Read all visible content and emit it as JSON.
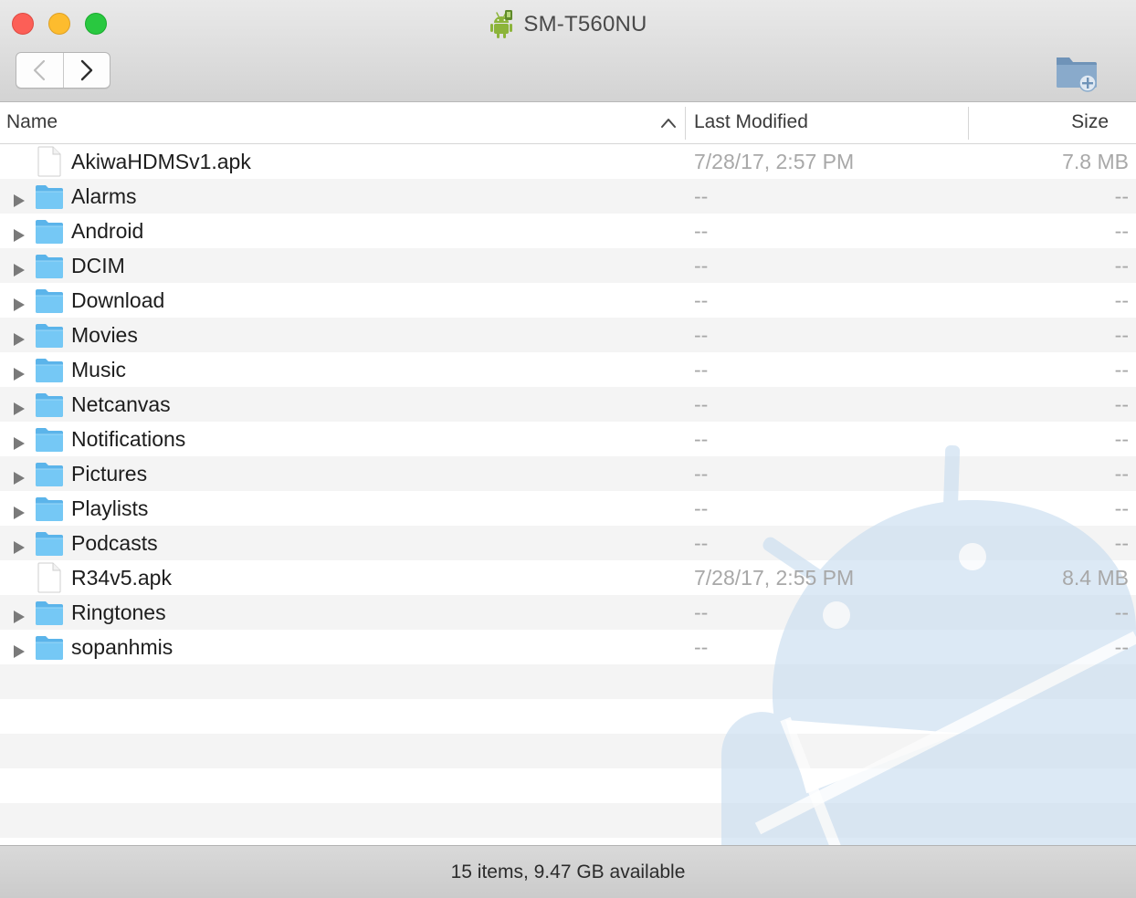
{
  "window": {
    "title": "SM-T560NU",
    "title_icon": "android-icon"
  },
  "toolbar": {
    "back_icon": "chevron-left-icon",
    "forward_icon": "chevron-right-icon",
    "new_folder_icon": "new-folder-icon"
  },
  "columns": {
    "name": "Name",
    "last_modified": "Last Modified",
    "size": "Size",
    "sort_indicator": "chevron-up-icon"
  },
  "rows": [
    {
      "name": "AkiwaHDMSv1.apk",
      "modified": "7/28/17, 2:57 PM",
      "size": "7.8 MB",
      "kind": "file"
    },
    {
      "name": "Alarms",
      "modified": "--",
      "size": "--",
      "kind": "folder"
    },
    {
      "name": "Android",
      "modified": "--",
      "size": "--",
      "kind": "folder"
    },
    {
      "name": "DCIM",
      "modified": "--",
      "size": "--",
      "kind": "folder"
    },
    {
      "name": "Download",
      "modified": "--",
      "size": "--",
      "kind": "folder"
    },
    {
      "name": "Movies",
      "modified": "--",
      "size": "--",
      "kind": "folder"
    },
    {
      "name": "Music",
      "modified": "--",
      "size": "--",
      "kind": "folder"
    },
    {
      "name": "Netcanvas",
      "modified": "--",
      "size": "--",
      "kind": "folder"
    },
    {
      "name": "Notifications",
      "modified": "--",
      "size": "--",
      "kind": "folder"
    },
    {
      "name": "Pictures",
      "modified": "--",
      "size": "--",
      "kind": "folder"
    },
    {
      "name": "Playlists",
      "modified": "--",
      "size": "--",
      "kind": "folder"
    },
    {
      "name": "Podcasts",
      "modified": "--",
      "size": "--",
      "kind": "folder"
    },
    {
      "name": "R34v5.apk",
      "modified": "7/28/17, 2:55 PM",
      "size": "8.4 MB",
      "kind": "file"
    },
    {
      "name": "Ringtones",
      "modified": "--",
      "size": "--",
      "kind": "folder"
    },
    {
      "name": "sopanhmis",
      "modified": "--",
      "size": "--",
      "kind": "folder"
    }
  ],
  "status": {
    "text": "15 items, 9.47 GB available"
  },
  "colors": {
    "folder": "#6cc3f2",
    "android_green": "#8cb43a",
    "watermark": "#c7dcf0"
  }
}
